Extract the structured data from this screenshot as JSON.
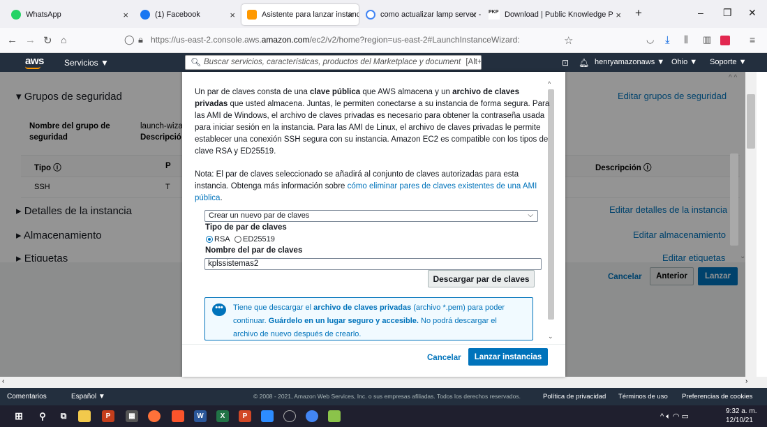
{
  "browser": {
    "tabs": [
      {
        "title": "WhatsApp",
        "icon": "whatsapp-icon",
        "color": "#25d366"
      },
      {
        "title": "(1) Facebook",
        "icon": "facebook-icon",
        "color": "#1877f2"
      },
      {
        "title": "Asistente para lanzar instancia |",
        "icon": "aws-icon",
        "color": "#ff9900"
      },
      {
        "title": "como actualizar lamp server - ",
        "icon": "google-icon",
        "color": "#4285f4"
      },
      {
        "title": "Download | Public Knowledge P",
        "icon": "pkp-icon",
        "color": "#222"
      }
    ],
    "url_prefix": "https://us-east-2.console.aws.",
    "url_domain": "amazon.com",
    "url_suffix": "/ec2/v2/home?region=us-east-2#LaunchInstanceWizard:"
  },
  "aws_header": {
    "logo": "aws",
    "services": "Servicios ▼",
    "search_placeholder": "Buscar servicios, características, productos del Marketplace y document",
    "search_shortcut": "[Alt+S]",
    "user": "henryamazonaws ▼",
    "region": "Ohio ▼",
    "support": "Soporte ▼"
  },
  "background": {
    "security_groups": "Grupos de seguridad",
    "edit_security_groups": "Editar grupos de seguridad",
    "group_name_label_1": "Nombre del grupo de",
    "group_name_label_2": "seguridad",
    "group_name_value": "launch-wiza",
    "description_label": "Descripció",
    "col_type": "Tipo",
    "col_p": "P",
    "col_description": "Descripción",
    "row_type": "SSH",
    "row_p": "T",
    "instance_details": "Detalles de la instancia",
    "edit_instance_details": "Editar detalles de la instancia",
    "storage": "Almacenamiento",
    "edit_storage": "Editar almacenamiento",
    "tags": "Etiquetas",
    "edit_tags": "Editar etiquetas",
    "cancel": "Cancelar",
    "previous": "Anterior",
    "launch": "Lanzar"
  },
  "modal": {
    "p1_line1_a": "Un par de claves consta de una ",
    "p1_line1_b": "clave pública",
    "p1_line1_c": " que AWS almacena y un ",
    "p1_line1_d": "archivo de claves",
    "p1_line2_a": "privadas",
    "p1_line2_b": " que usted almacena. Juntas, le permiten conectarse a su instancia de forma segura. Para",
    "p1_line3": "las AMI de Windows, el archivo de claves privadas es necesario para obtener la contraseña usada",
    "p1_line4": "para iniciar sesión en la instancia. Para las AMI de Linux, el archivo de claves privadas le permite",
    "p1_line5": "establecer una conexión SSH segura con su instancia. Amazon EC2 es compatible con los tipos de",
    "p1_line6": "clave RSA y ED25519.",
    "note_line1": "Nota: El par de claves seleccionado se añadirá al conjunto de claves autorizadas para esta",
    "note_line2_a": "instancia. Obtenga más información sobre ",
    "note_link_a": "cómo eliminar pares de claves existentes de una AMI",
    "note_link_b": "pública",
    "note_end": ".",
    "select_value": "Crear un nuevo par de claves",
    "keytype_label": "Tipo de par de claves",
    "radio_rsa": "RSA",
    "radio_ed": "ED25519",
    "keyname_label": "Nombre del par de claves",
    "keyname_value": "kplssistemas2",
    "download_button": "Descargar par de claves",
    "info_l1_a": "Tiene que descargar el ",
    "info_l1_b": "archivo de claves privadas",
    "info_l1_c": " (archivo *.pem) para poder",
    "info_l2_a": "continuar. ",
    "info_l2_b": "Guárdelo en un lugar seguro y accesible.",
    "info_l2_c": " No podrá descargar el",
    "info_l3": "archivo de nuevo después de crearlo.",
    "cancel": "Cancelar",
    "launch": "Lanzar instancias"
  },
  "footer": {
    "comments": "Comentarios",
    "language": "Español ▼",
    "copyright": "© 2008 - 2021, Amazon Web Services, Inc. o sus empresas afiliadas. Todos los derechos reservados.",
    "privacy": "Política de privacidad",
    "terms": "Términos de uso",
    "cookies": "Preferencias de cookies"
  },
  "taskbar": {
    "time": "9:32 a. m.",
    "date": "12/10/21"
  }
}
